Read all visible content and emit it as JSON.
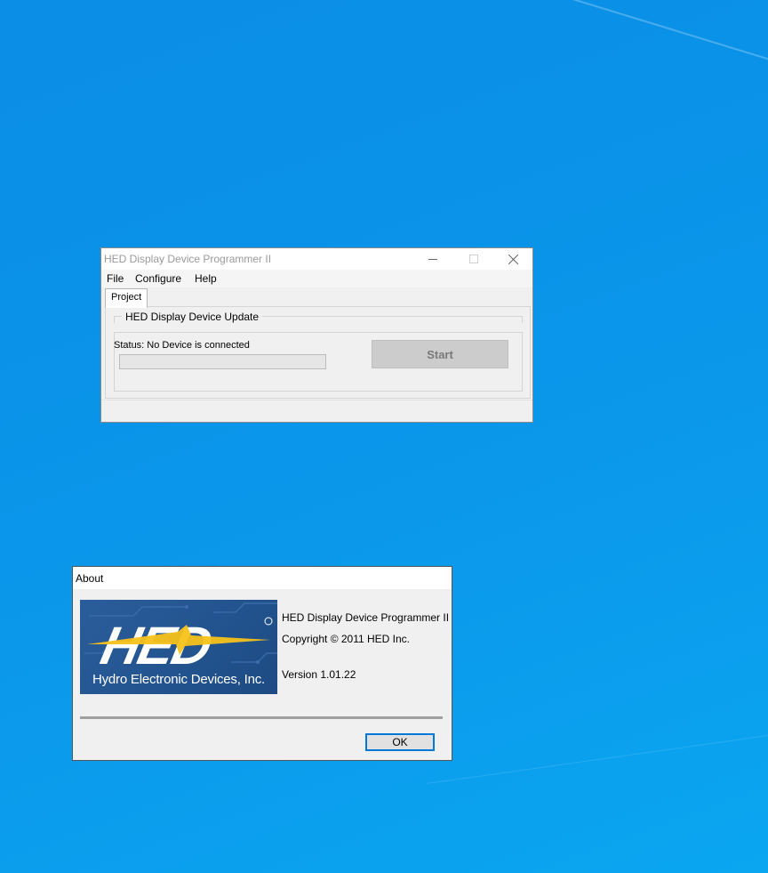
{
  "main_window": {
    "title": "HED Display Device Programmer II",
    "menu": {
      "file": "File",
      "configure": "Configure",
      "help": "Help"
    },
    "tab_label": "Project",
    "group_title": "HED Display Device Update",
    "status_text": "Status: No Device is connected",
    "progress_percent": 0,
    "start_label": "Start"
  },
  "about_dialog": {
    "title": "About",
    "logo_tagline": "Hydro Electronic Devices, Inc.",
    "logo_mark": "HED",
    "product_name": "HED Display Device Programmer II",
    "copyright": "Copyright © 2011 HED Inc.",
    "version": "Version 1.01.22",
    "ok_label": "OK"
  },
  "colors": {
    "desktop": "#0b93e8",
    "window_bg": "#f0f0f0",
    "focus_accent": "#0078d7",
    "logo_blue": "#23548f",
    "logo_yellow": "#f7c21a"
  },
  "icons": [
    "minimize-icon",
    "maximize-icon",
    "close-icon"
  ]
}
